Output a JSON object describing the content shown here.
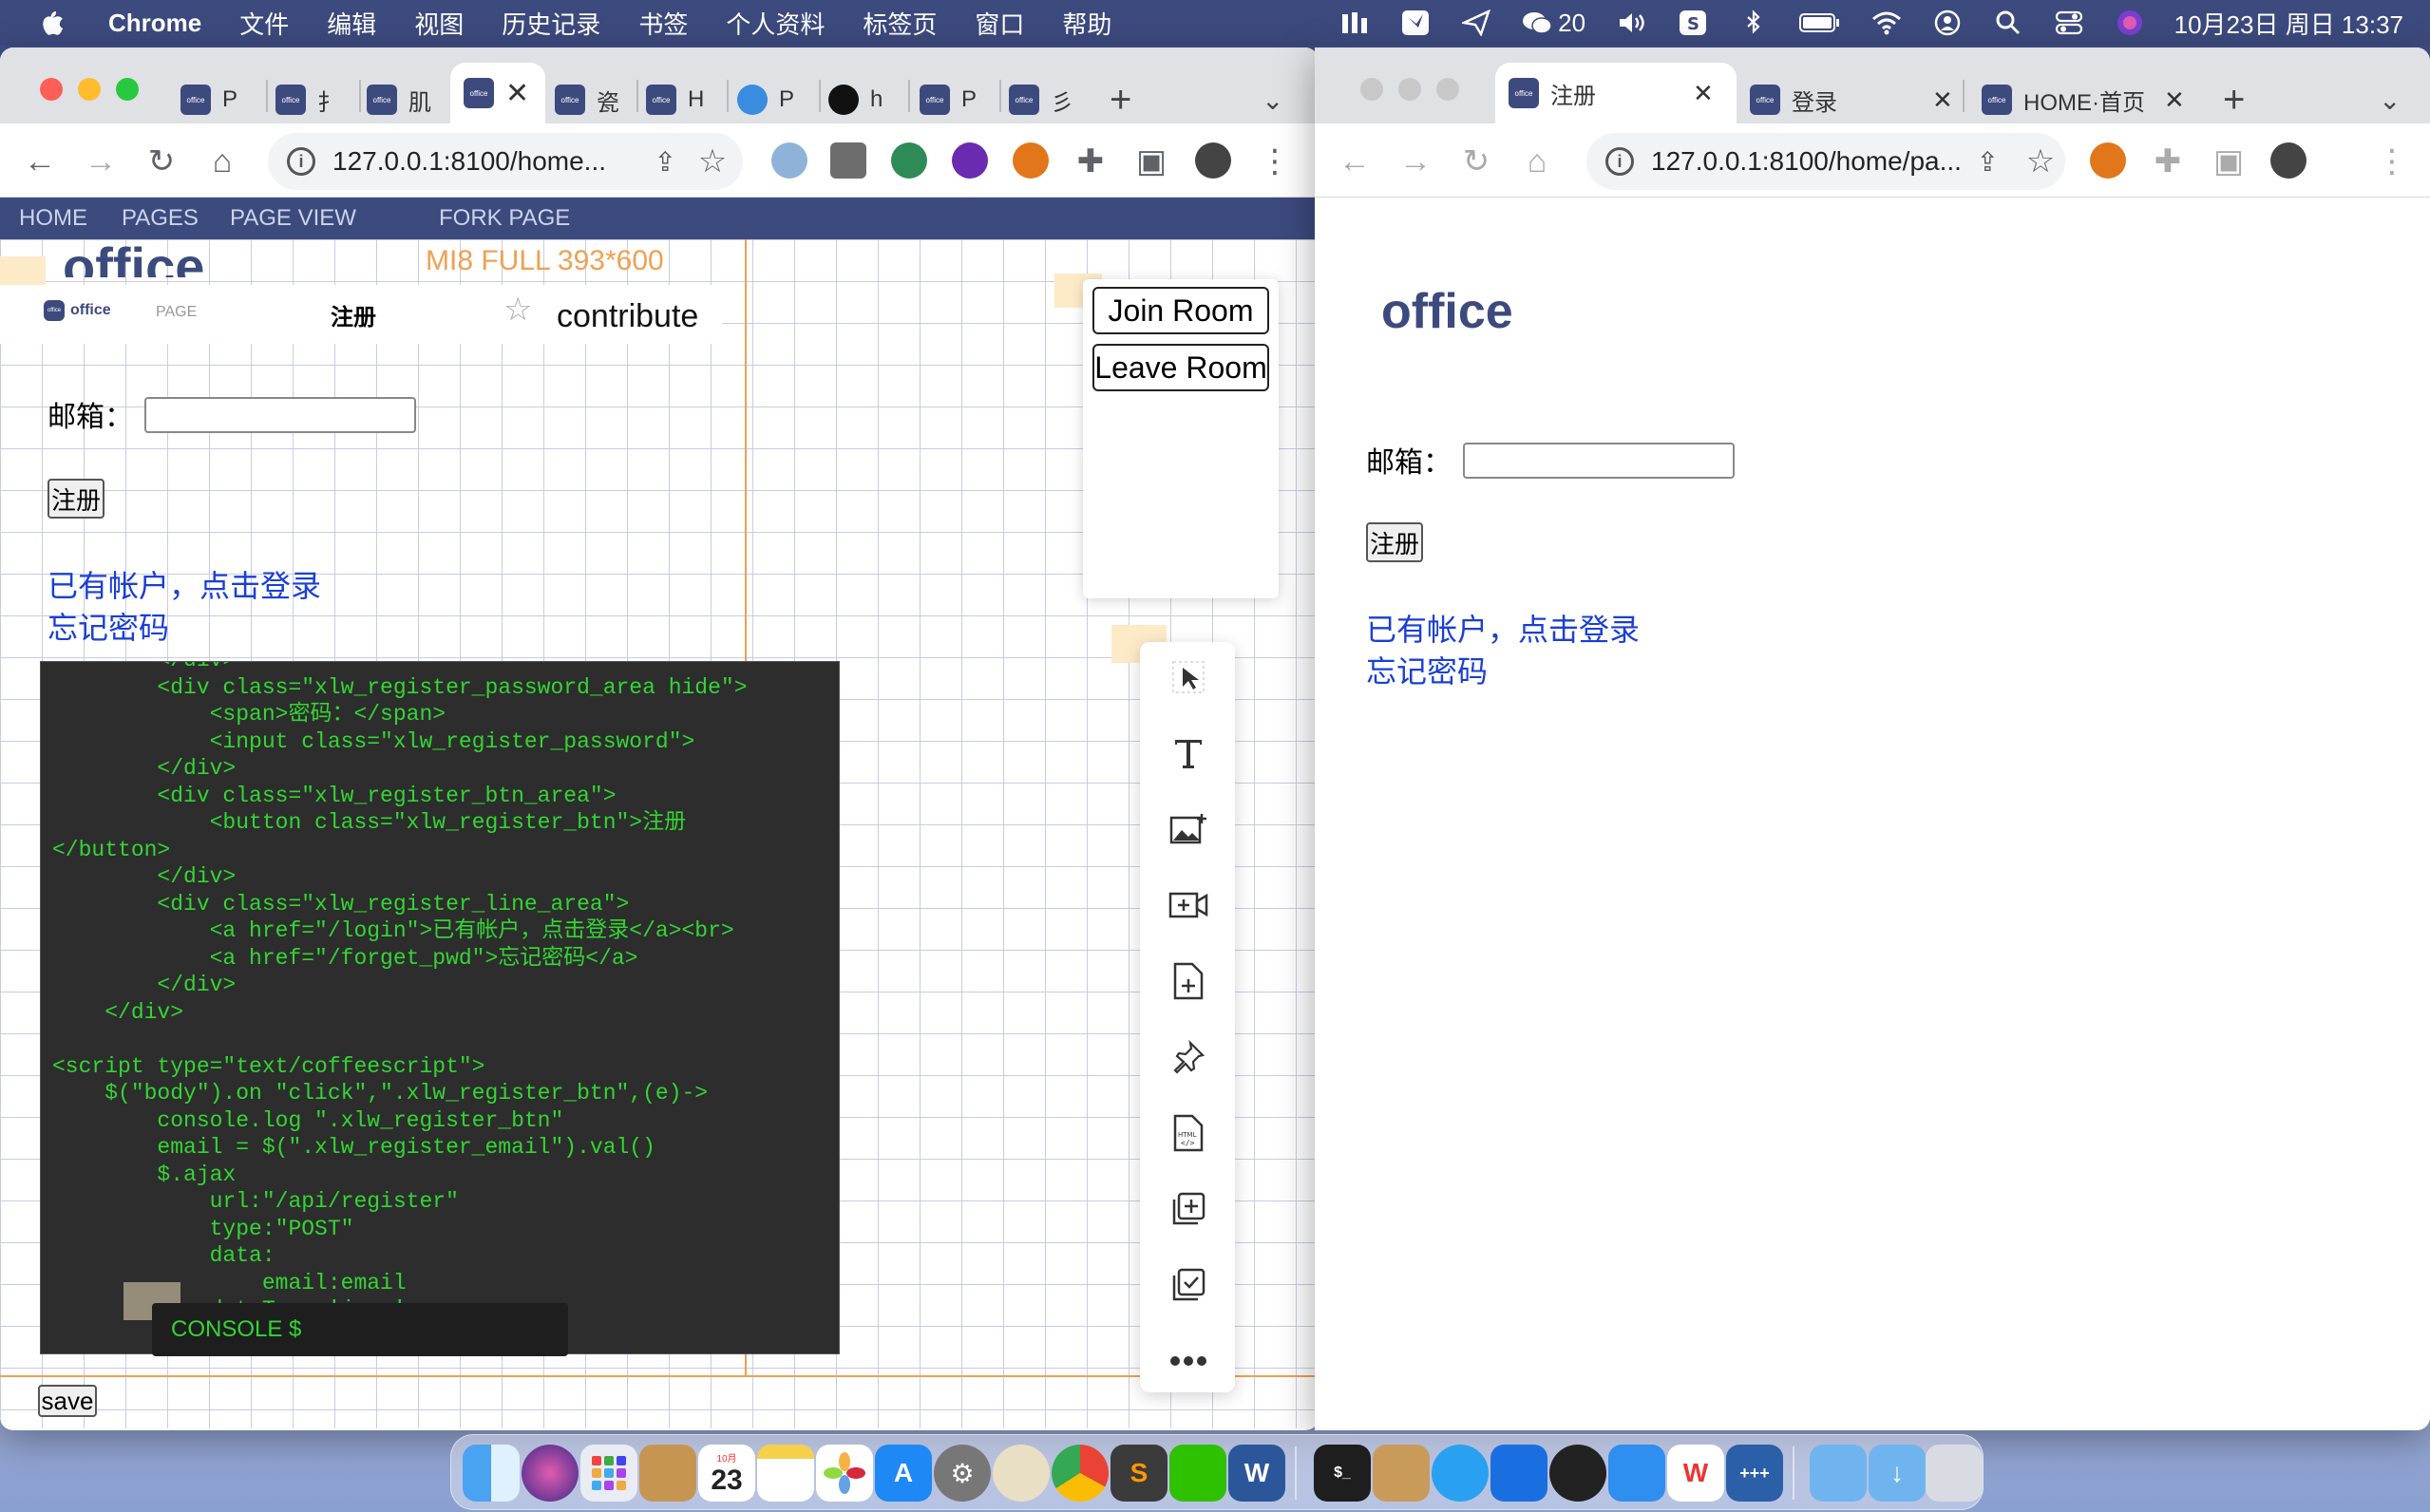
{
  "menubar": {
    "app": "Chrome",
    "items": [
      "文件",
      "编辑",
      "视图",
      "历史记录",
      "书签",
      "个人资料",
      "标签页",
      "窗口",
      "帮助"
    ],
    "wechat_count": "20",
    "datetime": "10月23日 周日  13:37"
  },
  "left_window": {
    "tabs": [
      {
        "label": "P"
      },
      {
        "label": "扌"
      },
      {
        "label": "肌"
      },
      {
        "label": ""
      },
      {
        "label": "瓷"
      },
      {
        "label": "H"
      },
      {
        "label": "P"
      },
      {
        "label": "h"
      },
      {
        "label": "P"
      },
      {
        "label": "彡"
      }
    ],
    "url": "127.0.0.1:8100/home...",
    "site_nav": [
      "HOME",
      "PAGES",
      "PAGE VIEW",
      "FORK PAGE"
    ],
    "page_heading": "office",
    "device_label": "MI8 FULL  393*600",
    "inner_header": {
      "logo": "office",
      "page": "PAGE",
      "title": "注册",
      "contribute": "contribute"
    },
    "form": {
      "email_label": "邮箱：",
      "email_value": "",
      "register_button": "注册",
      "login_link": "已有帐户，点击登录",
      "forgot_link": "忘记密码"
    },
    "room_buttons": {
      "join": "Join Room",
      "leave": "Leave Room"
    },
    "code": "        </div>\n        <div class=\"xlw_register_password_area hide\">\n            <span>密码：</span>\n            <input class=\"xlw_register_password\">\n        </div>\n        <div class=\"xlw_register_btn_area\">\n            <button class=\"xlw_register_btn\">注册\n</button>\n        </div>\n        <div class=\"xlw_register_line_area\">\n            <a href=\"/login\">已有帐户，点击登录</a><br>\n            <a href=\"/forget_pwd\">忘记密码</a>\n        </div>\n    </div>\n\n<script type=\"text/coffeescript\">\n    $(\"body\").on \"click\",\".xlw_register_btn\",(e)->\n        console.log \".xlw_register_btn\"\n        email = $(\".xlw_register_email\").val()\n        $.ajax\n            url:\"/api/register\"\n            type:\"POST\"\n            data:\n                email:email\n            dataType:'json'",
    "console_label": "CONSOLE $",
    "save_button": "save",
    "toolbox_icons": [
      "cursor-icon",
      "text-icon",
      "image-add-icon",
      "video-add-icon",
      "file-add-icon",
      "pin-icon",
      "html-file-icon",
      "add-box-icon",
      "checklist-icon",
      "more-icon"
    ]
  },
  "right_window": {
    "tabs": [
      {
        "label": "注册"
      },
      {
        "label": "登录"
      },
      {
        "label": "HOME·首页"
      }
    ],
    "url": "127.0.0.1:8100/home/pa...",
    "page_heading": "office",
    "form": {
      "email_label": "邮箱：",
      "email_value": "",
      "register_button": "注册",
      "login_link": "已有帐户，点击登录",
      "forgot_link": "忘记密码"
    }
  },
  "dock": {
    "apps": [
      "finder",
      "siri",
      "launchpad",
      "contacts",
      "calendar",
      "notes",
      "photos",
      "app-store",
      "system-preferences",
      "sequel",
      "chrome",
      "sublime",
      "wechat",
      "word",
      "terminal",
      "archive",
      "qq",
      "wps-docs",
      "cleaner",
      "feishu",
      "wps",
      "code-editor",
      "applications-folder",
      "downloads-folder",
      "trash"
    ],
    "calendar_day": "23",
    "calendar_month": "10月"
  }
}
